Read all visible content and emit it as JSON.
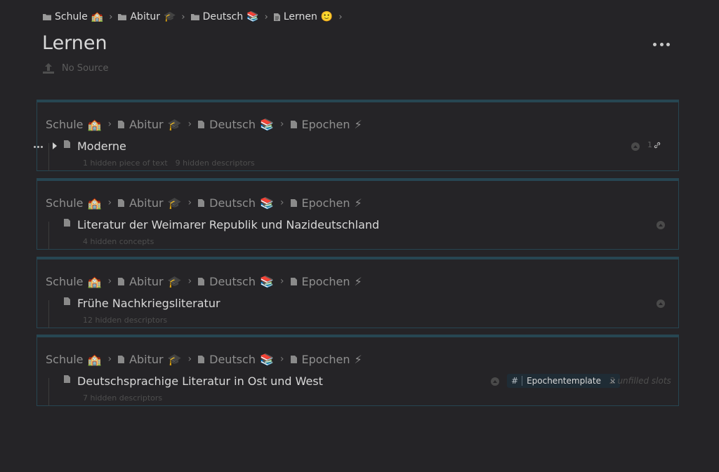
{
  "breadcrumb": [
    {
      "label": "Schule",
      "emoji": "🏫"
    },
    {
      "label": "Abitur",
      "emoji": "🎓"
    },
    {
      "label": "Deutsch",
      "emoji": "📚"
    },
    {
      "label": "Lernen",
      "emoji": "🙂"
    }
  ],
  "page": {
    "title": "Lernen",
    "source_label": "No Source"
  },
  "card_path": [
    {
      "label": "Schule",
      "emoji": "🏫"
    },
    {
      "label": "Abitur",
      "emoji": "🎓"
    },
    {
      "label": "Deutsch",
      "emoji": "📚"
    },
    {
      "label": "Epochen",
      "emoji": "⚡"
    }
  ],
  "cards": [
    {
      "title": "Moderne",
      "hidden": [
        "1 hidden piece of text",
        "9 hidden descriptors"
      ],
      "link_count": "1"
    },
    {
      "title": "Literatur der Weimarer Republik und Nazideutschland",
      "hidden": [
        "4 hidden concepts"
      ]
    },
    {
      "title": "Frühe Nachkriegsliteratur",
      "hidden": [
        "12 hidden descriptors"
      ]
    },
    {
      "title": "Deutschsprachige Literatur in Ost und West",
      "hidden": [
        "7 hidden descriptors"
      ],
      "tag": {
        "hash": "#",
        "label": "Epochentemplate",
        "remove": "×"
      },
      "unfilled": "2 unfilled slots"
    }
  ],
  "colors": {
    "card_border": "#274652",
    "background": "#252427"
  }
}
